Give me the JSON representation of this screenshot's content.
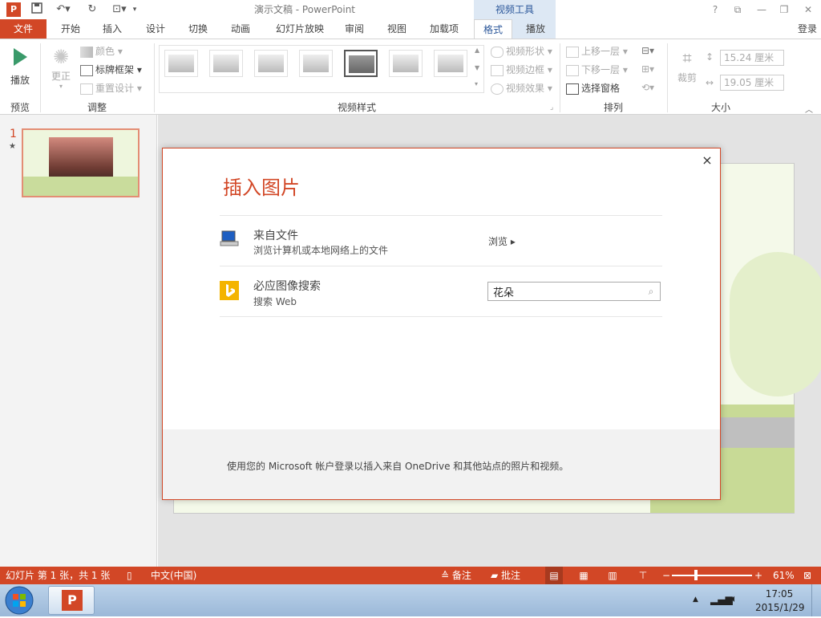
{
  "app": {
    "title": "演示文稿 - PowerPoint",
    "context_tab_group": "视频工具",
    "sign_in": "登录"
  },
  "tabs": [
    "文件",
    "开始",
    "插入",
    "设计",
    "切换",
    "动画",
    "幻灯片放映",
    "审阅",
    "视图",
    "加载项",
    "格式",
    "播放"
  ],
  "ribbon": {
    "preview": {
      "play_label": "播放",
      "group": "预览"
    },
    "adjust": {
      "correct_label": "更正",
      "color_label": "颜色",
      "poster_frame_label": "标牌框架",
      "reset_design_label": "重置设计",
      "group": "调整"
    },
    "video_styles": {
      "group": "视频样式",
      "shape_label": "视频形状",
      "border_label": "视频边框",
      "effects_label": "视频效果"
    },
    "arrange": {
      "group": "排列",
      "bring_forward_label": "上移一层",
      "send_backward_label": "下移一层",
      "selection_pane_label": "选择窗格"
    },
    "size": {
      "group": "大小",
      "crop_label": "裁剪",
      "height_value": "15.24 厘米",
      "width_value": "19.05 厘米"
    }
  },
  "slide_panel": {
    "slide_number": "1",
    "star": "★"
  },
  "dialog": {
    "title": "插入图片",
    "close": "×",
    "options": [
      {
        "title": "来自文件",
        "subtitle": "浏览计算机或本地网络上的文件",
        "action": "浏览 ▸"
      },
      {
        "title": "必应图像搜索",
        "subtitle": "搜索 Web",
        "search_value": "花朵"
      }
    ],
    "footer": "使用您的 Microsoft 帐户登录以插入来自 OneDrive 和其他站点的照片和视频。"
  },
  "status": {
    "slide_info": "幻灯片 第 1 张，共 1 张",
    "language": "中文(中国)",
    "notes_label": "备注",
    "comments_label": "批注",
    "zoom": "61%"
  },
  "taskbar": {
    "time": "17:05",
    "date": "2015/1/29"
  },
  "colors": {
    "accent": "#d24726",
    "context_tab": "#dde8f4",
    "ribbon_text": "#444444"
  }
}
